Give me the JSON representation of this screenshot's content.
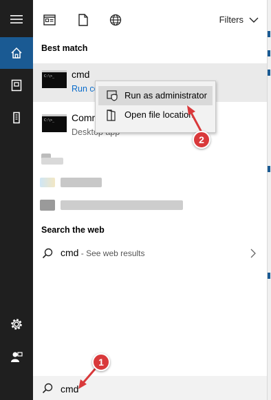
{
  "colors": {
    "rail": "#1f1f1f",
    "rail_active": "#1a5a93",
    "link": "#0a6ccb",
    "callout": "#d9393b",
    "menu_bg": "#f2f2f2",
    "menu_hover": "#d9d9d9"
  },
  "rail": {
    "items": [
      {
        "icon": "hamburger-menu-icon"
      },
      {
        "icon": "home-icon",
        "active": true
      },
      {
        "icon": "document-icon"
      },
      {
        "icon": "tower-pc-icon"
      },
      {
        "icon": "gear-icon"
      },
      {
        "icon": "user-feedback-icon"
      }
    ]
  },
  "toolbar": {
    "scopes": [
      {
        "icon": "apps-icon"
      },
      {
        "icon": "documents-icon"
      },
      {
        "icon": "web-globe-icon"
      }
    ],
    "filters_label": "Filters"
  },
  "best_match": {
    "heading": "Best match",
    "title": "cmd",
    "link_text": "Run co"
  },
  "second_result": {
    "title": "Comm",
    "subtitle": "Desktop app"
  },
  "search_web": {
    "heading": "Search the web",
    "query": "cmd",
    "hint": " - See web results"
  },
  "search_box": {
    "value": "cmd"
  },
  "context_menu": {
    "items": [
      {
        "label": "Run as administrator",
        "icon": "shield-icon"
      },
      {
        "label": "Open file location",
        "icon": "folder-open-icon"
      }
    ]
  },
  "callouts": [
    {
      "number": "1"
    },
    {
      "number": "2"
    }
  ]
}
